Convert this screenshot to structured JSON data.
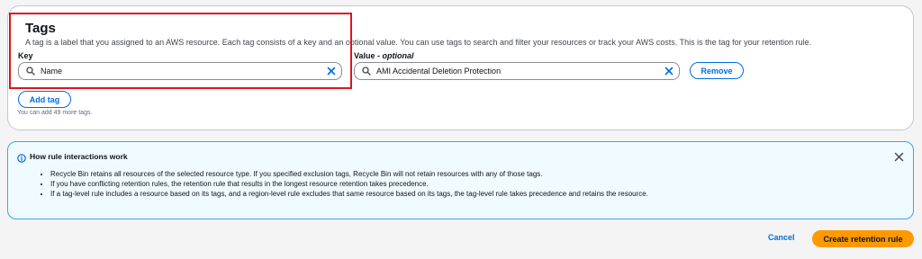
{
  "tags_section": {
    "title": "Tags",
    "description": "A tag is a label that you assigned to an AWS resource. Each tag consists of a key and an optional value. You can use tags to search and filter your resources or track your AWS costs. This is the tag for your retention rule.",
    "key_label": "Key",
    "value_label": "Value",
    "value_optional": "- optional",
    "key_value": "Name",
    "value_value": "AMI Accidental Deletion Protection",
    "remove_label": "Remove",
    "add_tag_label": "Add tag",
    "remaining_hint": "You can add 49 more tags."
  },
  "info_alert": {
    "title": "How rule interactions work",
    "items": [
      "Recycle Bin retains all resources of the selected resource type. If you specified exclusion tags, Recycle Bin will not retain resources with any of those tags.",
      "If you have conflicting retention rules, the retention rule that results in the longest resource retention takes precedence.",
      "If a tag-level rule includes a resource based on its tags, and a region-level rule excludes that same resource based on its tags, the tag-level rule takes precedence and retains the resource."
    ]
  },
  "footer": {
    "cancel_label": "Cancel",
    "create_label": "Create retention rule"
  },
  "colors": {
    "accent": "#006ce0",
    "primary_button": "#ff9900",
    "highlight_box": "#e0131c",
    "info_border": "#3aa5e8"
  },
  "icons": {
    "search": "search-icon",
    "clear": "close-icon",
    "info": "info-icon",
    "dismiss": "close-icon"
  }
}
